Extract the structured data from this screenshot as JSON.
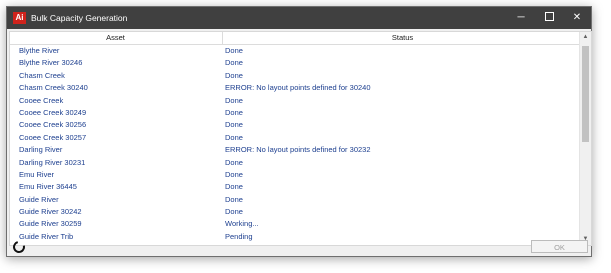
{
  "window": {
    "title": "Bulk Capacity Generation",
    "app_icon_text": "Ai"
  },
  "columns": {
    "asset": "Asset",
    "status": "Status"
  },
  "rows": [
    {
      "asset": "Blythe River",
      "status": "Done"
    },
    {
      "asset": "Blythe River 30246",
      "status": "Done"
    },
    {
      "asset": "Chasm Creek",
      "status": "Done"
    },
    {
      "asset": "Chasm Creek 30240",
      "status": "ERROR: No layout points defined for 30240"
    },
    {
      "asset": "Cooee Creek",
      "status": "Done"
    },
    {
      "asset": "Cooee Creek 30249",
      "status": "Done"
    },
    {
      "asset": "Cooee Creek 30256",
      "status": "Done"
    },
    {
      "asset": "Cooee Creek 30257",
      "status": "Done"
    },
    {
      "asset": "Darling River",
      "status": "ERROR: No layout points defined for 30232"
    },
    {
      "asset": "Darling River 30231",
      "status": "Done"
    },
    {
      "asset": "Emu River",
      "status": "Done"
    },
    {
      "asset": "Emu River 36445",
      "status": "Done"
    },
    {
      "asset": "Guide River",
      "status": "Done"
    },
    {
      "asset": "Guide River 30242",
      "status": "Done"
    },
    {
      "asset": "Guide River 30259",
      "status": "Working..."
    },
    {
      "asset": "Guide River Trib",
      "status": "Pending"
    }
  ],
  "buttons": {
    "ok": "OK"
  },
  "icons": {
    "minimize": "minimize-icon",
    "maximize": "maximize-icon",
    "close": "close-icon",
    "busy": "busy-spinner-icon"
  }
}
